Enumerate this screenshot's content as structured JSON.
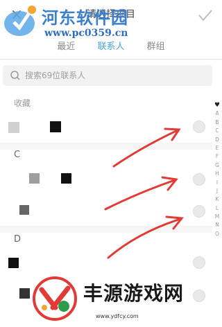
{
  "header": {
    "close_icon": "×",
    "title": "请选择项目",
    "confirm_icon": "check-icon"
  },
  "tabs": [
    {
      "label": "最近",
      "active": false
    },
    {
      "label": "联系人",
      "active": true
    },
    {
      "label": "群组",
      "active": false
    }
  ],
  "search": {
    "placeholder": "搜索69位联系人"
  },
  "sections": {
    "favorites": "收藏",
    "c": "C",
    "d": "D"
  },
  "index_bar": [
    "♥",
    "A",
    "B",
    "C",
    "D",
    "E",
    "F",
    "G",
    "H",
    "I",
    "J",
    "K",
    "L",
    "M",
    "N",
    "O"
  ],
  "watermark_top": {
    "name": "河东软件园",
    "url": "www.pc0359.cn"
  },
  "watermark_bottom": {
    "name": "丰源游戏网",
    "url": "www.ydfcy.com"
  },
  "colors": {
    "accent": "#46a4d8",
    "arrow": "#e53935"
  }
}
